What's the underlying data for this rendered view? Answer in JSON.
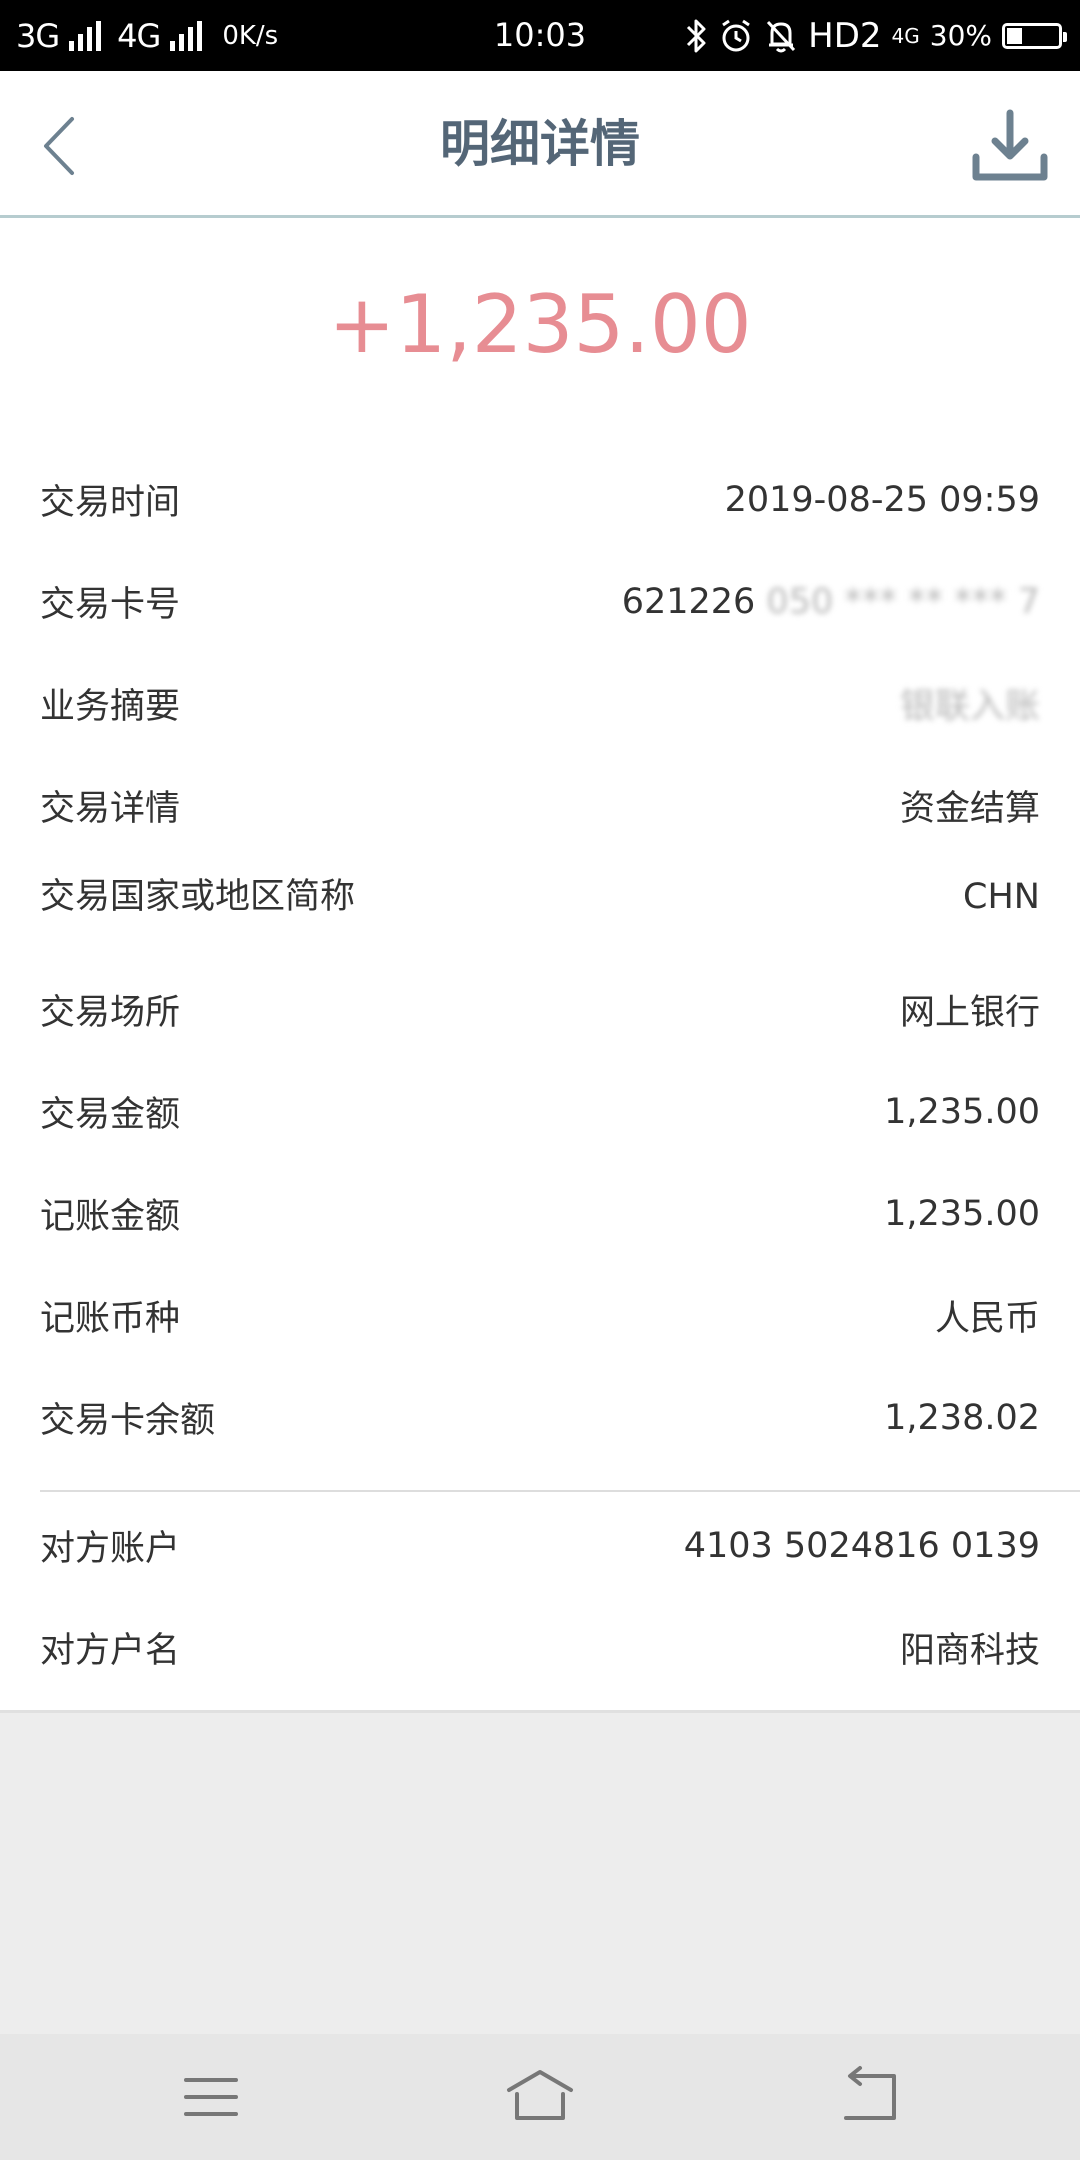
{
  "status_bar": {
    "net1": "3G",
    "net2": "4G",
    "speed": "0K/s",
    "time": "10:03",
    "hd": "HD2",
    "net3": "4G",
    "battery": "30%",
    "battery_level": 0.3
  },
  "header": {
    "title": "明细详情"
  },
  "amount": "+1,235.00",
  "details": [
    {
      "label": "交易时间",
      "value": "2019-08-25 09:59"
    },
    {
      "label": "交易卡号",
      "value": "621226 ",
      "masked": "050 *** ** *** 7"
    },
    {
      "label": "业务摘要",
      "value": "",
      "masked": "银联入账"
    },
    {
      "label": "交易详情",
      "value": "资金结算"
    },
    {
      "label": "交易国家或地区简称",
      "value": "CHN"
    },
    {
      "label": "交易场所",
      "value": "网上银行"
    },
    {
      "label": "交易金额",
      "value": "1,235.00"
    },
    {
      "label": "记账金额",
      "value": "1,235.00"
    },
    {
      "label": "记账币种",
      "value": "人民币"
    },
    {
      "label": "交易卡余额",
      "value": "1,238.02"
    }
  ],
  "counterparty": [
    {
      "label": "对方账户",
      "value": "4103 5024816 0139"
    },
    {
      "label": "对方户名",
      "value": "阳商科技"
    }
  ],
  "colors": {
    "amount": "#e78d93",
    "title": "#546677",
    "header_border": "#b6cccf"
  },
  "icons": {
    "back": "chevron-left-icon",
    "download": "download-icon",
    "menu": "menu-icon",
    "home": "home-icon",
    "return": "return-icon"
  }
}
